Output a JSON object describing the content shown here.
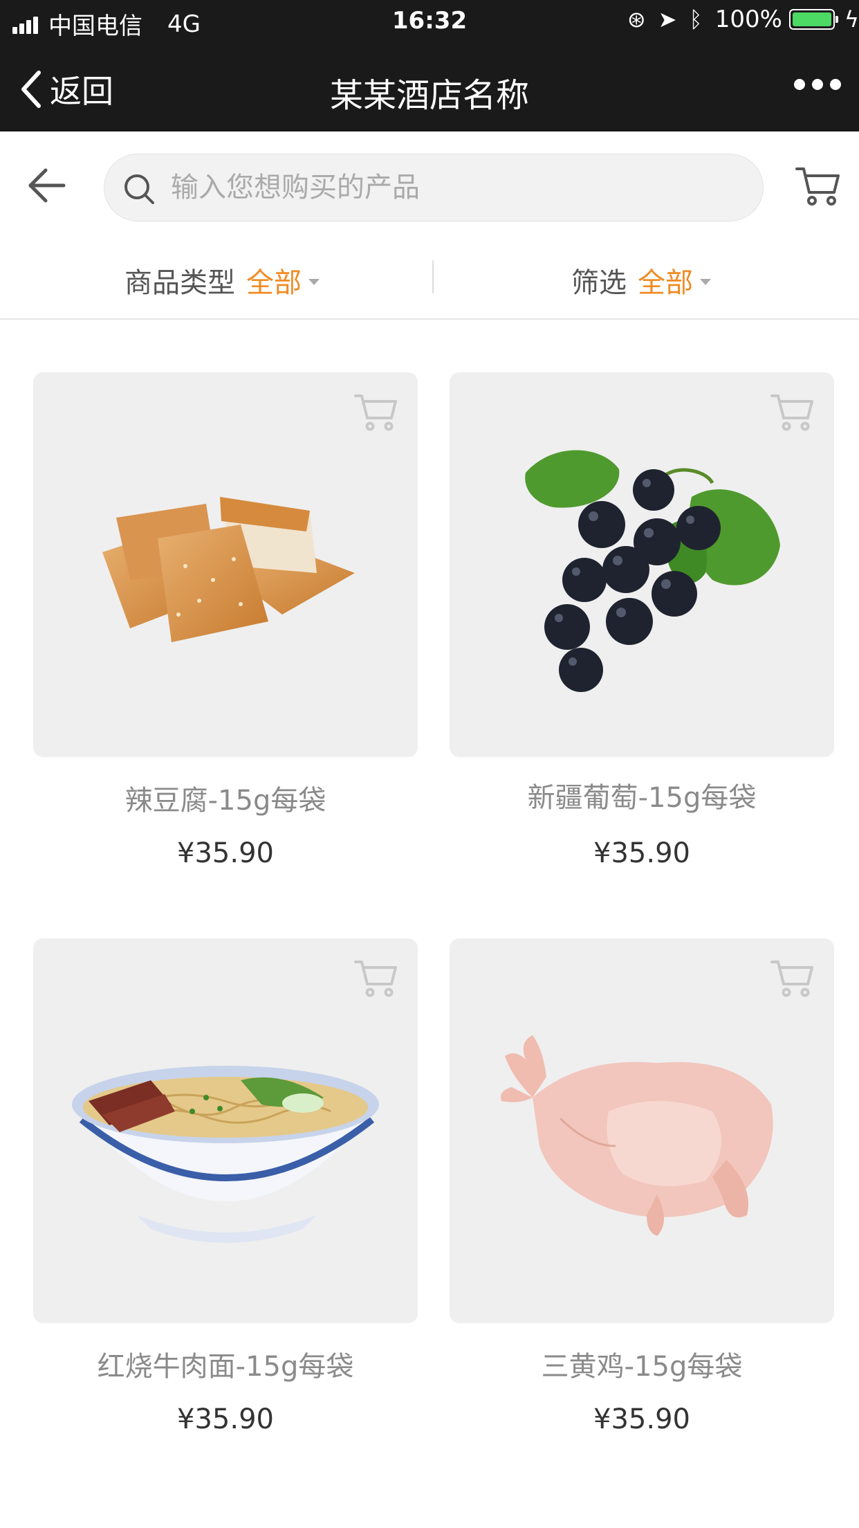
{
  "status_bar": {
    "carrier": "中国电信",
    "network": "4G",
    "time": "16:32",
    "battery": "100%"
  },
  "nav": {
    "back_label": "返回",
    "title": "某某酒店名称"
  },
  "search": {
    "placeholder": "输入您想购买的产品"
  },
  "filters": {
    "type_label": "商品类型",
    "type_value": "全部",
    "screen_label": "筛选",
    "screen_value": "全部"
  },
  "colors": {
    "accent": "#f08a24",
    "bar_bg": "#1a1a1a",
    "card_bg": "#efefef"
  },
  "products": [
    {
      "name": "辣豆腐-15g每袋",
      "price": "¥35.90",
      "image": "fried-tofu-image"
    },
    {
      "name": "新疆葡萄-15g每袋",
      "price": "¥35.90",
      "image": "grapes-image"
    },
    {
      "name": "红烧牛肉面-15g每袋",
      "price": "¥35.90",
      "image": "beef-noodles-image"
    },
    {
      "name": "三黄鸡-15g每袋",
      "price": "¥35.90",
      "image": "whole-chicken-image"
    }
  ]
}
